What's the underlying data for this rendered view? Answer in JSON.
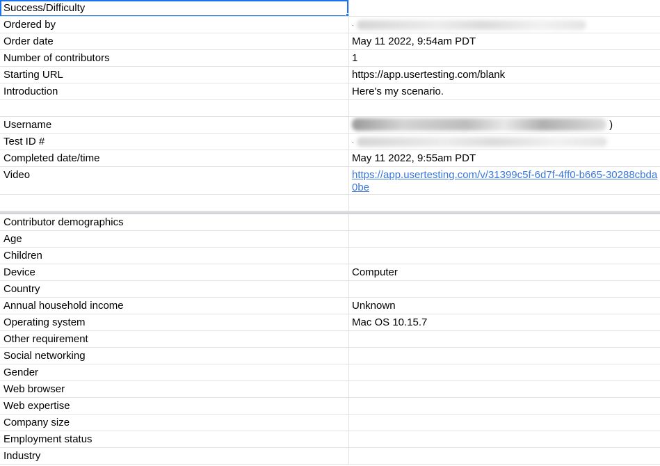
{
  "sheet": {
    "rows": [
      {
        "label": "Success/Difficulty",
        "value": ""
      },
      {
        "label": "Ordered by",
        "value": "",
        "redacted": true
      },
      {
        "label": "Order date",
        "value": "May 11 2022, 9:54am PDT"
      },
      {
        "label": "Number of contributors",
        "value": "1"
      },
      {
        "label": "Starting URL",
        "value": "https://app.usertesting.com/blank"
      },
      {
        "label": "Introduction",
        "value": "Here's my scenario."
      },
      {
        "label": "",
        "value": ""
      },
      {
        "label": "Username",
        "value": ")",
        "redacted": true
      },
      {
        "label": "Test ID #",
        "value": "",
        "redacted": true
      },
      {
        "label": "Completed date/time",
        "value": "May 11 2022, 9:55am PDT"
      },
      {
        "label": "Video",
        "value": "https://app.usertesting.com/v/31399c5f-6d7f-4ff0-b665-30288cbda0be",
        "link": true
      },
      {
        "label": "",
        "value": ""
      }
    ],
    "demographics": [
      {
        "label": "Contributor demographics",
        "value": ""
      },
      {
        "label": "Age",
        "value": ""
      },
      {
        "label": "Children",
        "value": ""
      },
      {
        "label": "Device",
        "value": "Computer"
      },
      {
        "label": "Country",
        "value": ""
      },
      {
        "label": "Annual household income",
        "value": "Unknown"
      },
      {
        "label": "Operating system",
        "value": "Mac OS 10.15.7"
      },
      {
        "label": "Other requirement",
        "value": ""
      },
      {
        "label": "Social networking",
        "value": ""
      },
      {
        "label": "Gender",
        "value": ""
      },
      {
        "label": "Web browser",
        "value": ""
      },
      {
        "label": "Web expertise",
        "value": ""
      },
      {
        "label": "Company size",
        "value": ""
      },
      {
        "label": "Employment status",
        "value": ""
      },
      {
        "label": "Industry",
        "value": ""
      }
    ]
  },
  "colors": {
    "selection": "#1a73e8",
    "link": "#3c78d8",
    "gridline": "#e2e2e2"
  }
}
